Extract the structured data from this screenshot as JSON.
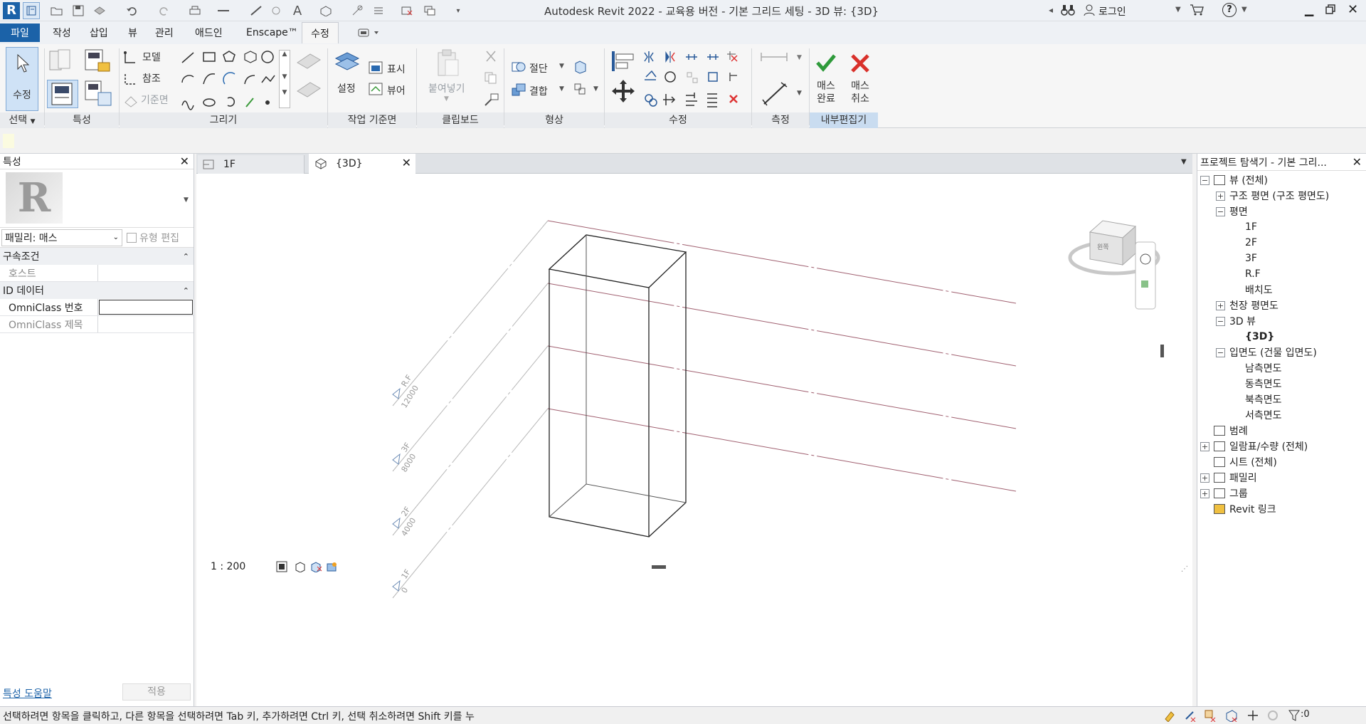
{
  "window": {
    "title": "Autodesk Revit 2022 - 교육용 버전 - 기본 그리드 세팅 - 3D 뷰: {3D}",
    "signin": "로그인"
  },
  "tabs": [
    "파일",
    "작성",
    "삽입",
    "뷰",
    "관리",
    "애드인",
    "Enscape™",
    "수정"
  ],
  "ribbon": {
    "modify_label": "수정",
    "select_label": "선택",
    "panels": [
      "특성",
      "그리기",
      "작업 기준면",
      "클립보드",
      "형상",
      "수정",
      "측정",
      "내부편집기"
    ],
    "model": "모델",
    "reference": "참조",
    "workplane_base": "기준면",
    "set": "설정",
    "show": "표시",
    "viewer": "뷰어",
    "paste": "붙여넣기",
    "cut": "절단",
    "join": "결합",
    "finish_mass": [
      "매스",
      "완료"
    ],
    "cancel_mass": [
      "매스",
      "취소"
    ]
  },
  "properties": {
    "title": "특성",
    "family": "패밀리: 매스",
    "edit_type": "유형 편집",
    "constraints_header": "구속조건",
    "host_label": "호스트",
    "id_header": "ID 데이터",
    "omni_number": "OmniClass 번호",
    "omni_title": "OmniClass 제목",
    "help_link": "특성 도움말",
    "apply": "적용"
  },
  "view_tabs": [
    {
      "label": "1F",
      "icon": "floor-plan-icon"
    },
    {
      "label": "{3D}",
      "icon": "3d-view-icon"
    }
  ],
  "viewport": {
    "levels": [
      {
        "name": "R.F",
        "elev": "12000"
      },
      {
        "name": "3F",
        "elev": "8000"
      },
      {
        "name": "2F",
        "elev": "4000"
      },
      {
        "name": "1F",
        "elev": "0"
      }
    ],
    "viewcube_face": "왼쪽",
    "scale": "1 : 200"
  },
  "browser": {
    "title": "프로젝트 탐색기 - 기본 그리...",
    "items": [
      {
        "label": "뷰 (전체)",
        "level": 0,
        "toggle": "−"
      },
      {
        "label": "구조 평면 (구조 평면도)",
        "level": 1,
        "toggle": "+"
      },
      {
        "label": "평면",
        "level": 1,
        "toggle": "−"
      },
      {
        "label": "1F",
        "level": 2,
        "toggle": ""
      },
      {
        "label": "2F",
        "level": 2,
        "toggle": ""
      },
      {
        "label": "3F",
        "level": 2,
        "toggle": ""
      },
      {
        "label": "R.F",
        "level": 2,
        "toggle": ""
      },
      {
        "label": "배치도",
        "level": 2,
        "toggle": ""
      },
      {
        "label": "천장 평면도",
        "level": 1,
        "toggle": "+"
      },
      {
        "label": "3D 뷰",
        "level": 1,
        "toggle": "−"
      },
      {
        "label": "{3D}",
        "level": 2,
        "toggle": "",
        "bold": true
      },
      {
        "label": "입면도 (건물 입면도)",
        "level": 1,
        "toggle": "−"
      },
      {
        "label": "남측면도",
        "level": 2,
        "toggle": ""
      },
      {
        "label": "동측면도",
        "level": 2,
        "toggle": ""
      },
      {
        "label": "북측면도",
        "level": 2,
        "toggle": ""
      },
      {
        "label": "서측면도",
        "level": 2,
        "toggle": ""
      },
      {
        "label": "범례",
        "level": 0,
        "toggle": ""
      },
      {
        "label": "일람표/수량 (전체)",
        "level": 0,
        "toggle": "+"
      },
      {
        "label": "시트 (전체)",
        "level": 0,
        "toggle": ""
      },
      {
        "label": "패밀리",
        "level": 0,
        "toggle": "+"
      },
      {
        "label": "그룹",
        "level": 0,
        "toggle": "+"
      },
      {
        "label": "Revit 링크",
        "level": 0,
        "toggle": ""
      }
    ]
  },
  "status": {
    "message": "선택하려면 항목을 클릭하고, 다른 항목을 선택하려면 Tab 키, 추가하려면 Ctrl 키, 선택 취소하려면 Shift 키를 누",
    "filter_count": ":0"
  },
  "colors": {
    "file_tab": "#1b62a8",
    "level_line": "#a06070",
    "check": "#2e9a3a",
    "cancel": "#d9312b"
  }
}
